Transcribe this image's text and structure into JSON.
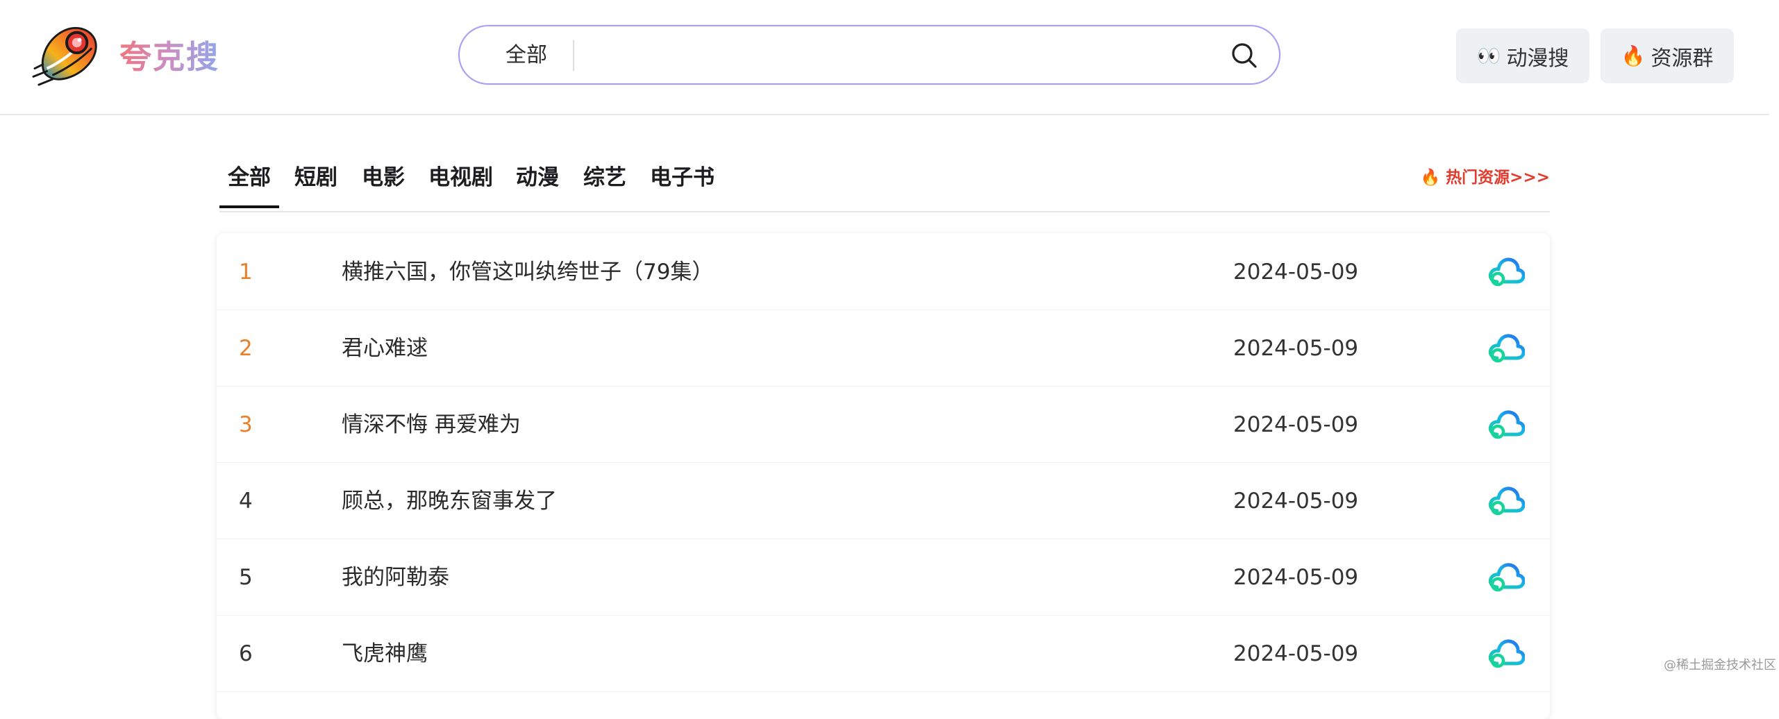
{
  "header": {
    "brand": "夸克搜",
    "search": {
      "category": "全部",
      "value": ""
    },
    "buttons": [
      {
        "emoji": "👀",
        "label": "动漫搜"
      },
      {
        "emoji": "🔥",
        "label": "资源群"
      }
    ]
  },
  "tabs": [
    "全部",
    "短剧",
    "电影",
    "电视剧",
    "动漫",
    "综艺",
    "电子书"
  ],
  "active_tab": "全部",
  "hot_link": "🔥 热门资源>>>",
  "list": [
    {
      "rank": "1",
      "title": "横推六国，你管这叫纨绔世子（79集）",
      "date": "2024-05-09"
    },
    {
      "rank": "2",
      "title": "君心难逑",
      "date": "2024-05-09"
    },
    {
      "rank": "3",
      "title": "情深不悔 再爱难为",
      "date": "2024-05-09"
    },
    {
      "rank": "4",
      "title": "顾总，那晚东窗事发了",
      "date": "2024-05-09"
    },
    {
      "rank": "5",
      "title": "我的阿勒泰",
      "date": "2024-05-09"
    },
    {
      "rank": "6",
      "title": "飞虎神鹰",
      "date": "2024-05-09"
    }
  ],
  "colors": {
    "top_rank": "#e8802a",
    "rank": "#333333",
    "search_border": "#a99cf1",
    "hot": "#e23a2c"
  },
  "icons": {
    "logo": "rocket-logo-icon",
    "search": "search-icon",
    "row_action": "cloud-icon"
  },
  "watermark": "@稀土掘金技术社区"
}
